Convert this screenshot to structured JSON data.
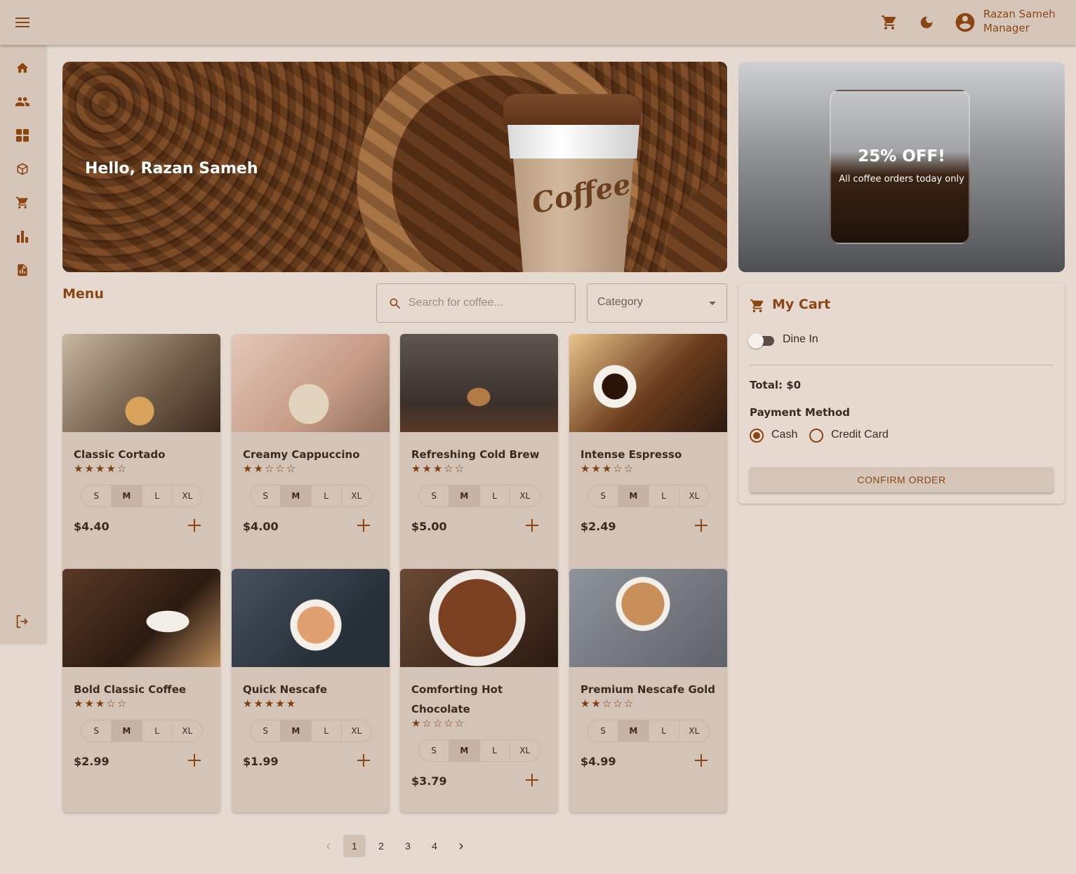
{
  "header": {
    "user_name": "Razan Sameh",
    "user_role": "Manager",
    "icons": [
      "menu-icon",
      "cart-icon",
      "dark-mode-icon",
      "account-icon"
    ]
  },
  "sidebar": {
    "items": [
      "home-icon",
      "people-icon",
      "dashboard-icon",
      "inventory-icon",
      "cart-icon",
      "bar-chart-icon",
      "report-icon"
    ],
    "logout": "logout-icon"
  },
  "hero": {
    "greeting": "Hello, Razan Sameh",
    "cup_text": "Coffee"
  },
  "promo": {
    "title": "25% OFF!",
    "subtitle": "All coffee orders today only"
  },
  "menu": {
    "title": "Menu",
    "search_placeholder": "Search for coffee...",
    "category_label": "Category"
  },
  "sizes": [
    "S",
    "M",
    "L",
    "XL"
  ],
  "products": [
    {
      "name": "Classic Cortado",
      "rating": 4,
      "stars": "★★★★☆",
      "price": "$4.40",
      "selected_size": "M"
    },
    {
      "name": "Creamy Cappuccino",
      "rating": 2,
      "stars": "★★☆☆☆",
      "price": "$4.00",
      "selected_size": "M"
    },
    {
      "name": "Refreshing Cold Brew",
      "rating": 3,
      "stars": "★★★☆☆",
      "price": "$5.00",
      "selected_size": "M"
    },
    {
      "name": "Intense Espresso",
      "rating": 3,
      "stars": "★★★☆☆",
      "price": "$2.49",
      "selected_size": "M"
    },
    {
      "name": "Bold Classic Coffee",
      "rating": 3,
      "stars": "★★★☆☆",
      "price": "$2.99",
      "selected_size": "M"
    },
    {
      "name": "Quick Nescafe",
      "rating": 5,
      "stars": "★★★★★",
      "price": "$1.99",
      "selected_size": "M"
    },
    {
      "name": "Comforting Hot Chocolate",
      "rating": 1,
      "stars": "★☆☆☆☆",
      "price": "$3.79",
      "selected_size": "M"
    },
    {
      "name": "Premium Nescafe Gold",
      "rating": 2,
      "stars": "★★☆☆☆",
      "price": "$4.99",
      "selected_size": "M"
    }
  ],
  "cart": {
    "title": "My Cart",
    "dine_in_label": "Dine In",
    "dine_in": false,
    "total": "Total: $0",
    "payment_label": "Payment Method",
    "payment_options": [
      "Cash",
      "Credit Card"
    ],
    "payment_selected": "Cash",
    "confirm_label": "CONFIRM ORDER"
  },
  "pagination": {
    "pages": [
      "1",
      "2",
      "3",
      "4"
    ],
    "current": "1",
    "prev": "‹",
    "next": "›"
  },
  "colors": {
    "background": "#e6dad0",
    "surface": "#d6c6b9",
    "accent": "#8b4513",
    "text": "#3b2a20"
  }
}
